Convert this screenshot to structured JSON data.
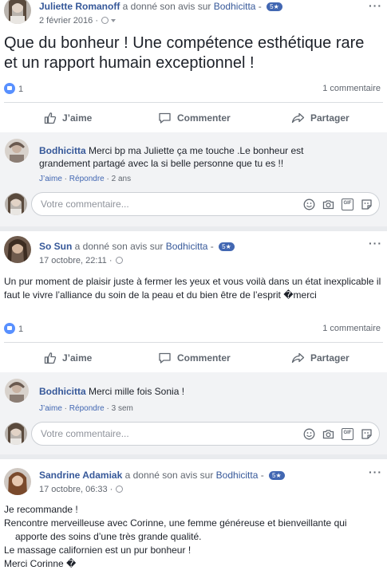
{
  "posts": [
    {
      "author": "Juliette Romanoff",
      "action": " a donné son avis sur ",
      "page": "Bodhicitta",
      "dash": " - ",
      "rating": "5★",
      "date": "2 février 2016 ·",
      "text": "Que du bonheur ! Une compétence esthétique rare et un rapport humain exceptionnel !",
      "like_count": "1",
      "comment_count": "1 commentaire",
      "comment": {
        "author": "Bodhicitta",
        "text": " Merci bp ma Juliette ça me touche .Le bonheur est grandement partagé avec la si belle personne que tu es !!",
        "like_label": "J’aime",
        "reply_label": "Répondre",
        "time": "2 ans"
      }
    },
    {
      "author": "So Sun",
      "action": " a donné son avis sur ",
      "page": "Bodhicitta",
      "dash": " - ",
      "rating": "5★",
      "date": "17 octobre, 22:11 ·",
      "text": "Un pur moment de plaisir juste à fermer les yeux et vous voilà dans un état inexplicable il faut le vivre l’alliance du soin de la peau et du bien être de l’esprit �merci",
      "like_count": "1",
      "comment_count": "1 commentaire",
      "comment": {
        "author": "Bodhicitta",
        "text": " Merci mille fois Sonia !",
        "like_label": "J’aime",
        "reply_label": "Répondre",
        "time": "3 sem"
      }
    },
    {
      "author": "Sandrine Adamiak",
      "action": " a donné son avis sur ",
      "page": "Bodhicitta",
      "dash": " - ",
      "rating": "5★",
      "date": "17 octobre, 06:33 ·",
      "lines": [
        "Je recommande !",
        "Rencontre merveilleuse avec Corinne, une femme généreuse et bienveillante qui",
        "apporte des soins d’une très grande qualité.",
        "Le massage californien est un pur bonheur !",
        "Merci Corinne �"
      ]
    }
  ],
  "actions": {
    "like": "J’aime",
    "comment": "Commenter",
    "share": "Partager"
  },
  "comment_input": {
    "placeholder": "Votre commentaire..."
  },
  "colors": {
    "link": "#365899",
    "accent": "#4267b2",
    "like": "#5890ff",
    "background": "#e9ebee"
  },
  "icons": [
    "more-options-icon",
    "globe-icon",
    "like-icon",
    "comment-icon",
    "share-icon",
    "emoji-icon",
    "camera-icon",
    "gif-icon",
    "sticker-icon"
  ]
}
